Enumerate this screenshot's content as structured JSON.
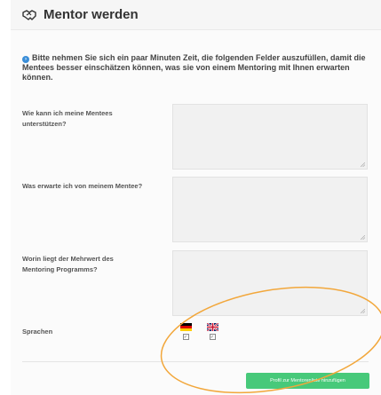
{
  "header": {
    "title": "Mentor werden",
    "icon": "handshake-icon"
  },
  "info": {
    "icon": "info-icon",
    "text": "Bitte nehmen Sie sich ein paar Minuten Zeit, die folgenden Felder auszufüllen, damit die Mentees besser einschätzen können, was sie von einem Mentoring mit Ihnen erwarten können."
  },
  "fields": [
    {
      "label": "Wie kann ich meine Mentees unterstützen?",
      "value": ""
    },
    {
      "label": "Was erwarte ich von meinem Mentee?",
      "value": ""
    },
    {
      "label": "Worin liegt der Mehrwert des Mentoring Programms?",
      "value": ""
    }
  ],
  "languages": {
    "label": "Sprachen",
    "options": [
      {
        "name": "german-flag-icon",
        "checked": true
      },
      {
        "name": "uk-flag-icon",
        "checked": true
      }
    ]
  },
  "submit": {
    "label": "Profil zur Mentorenliste hinzufügen"
  },
  "colors": {
    "accent_button": "#47c97a",
    "info_icon": "#3a8ed8",
    "highlight_ellipse": "#f2a73b"
  }
}
